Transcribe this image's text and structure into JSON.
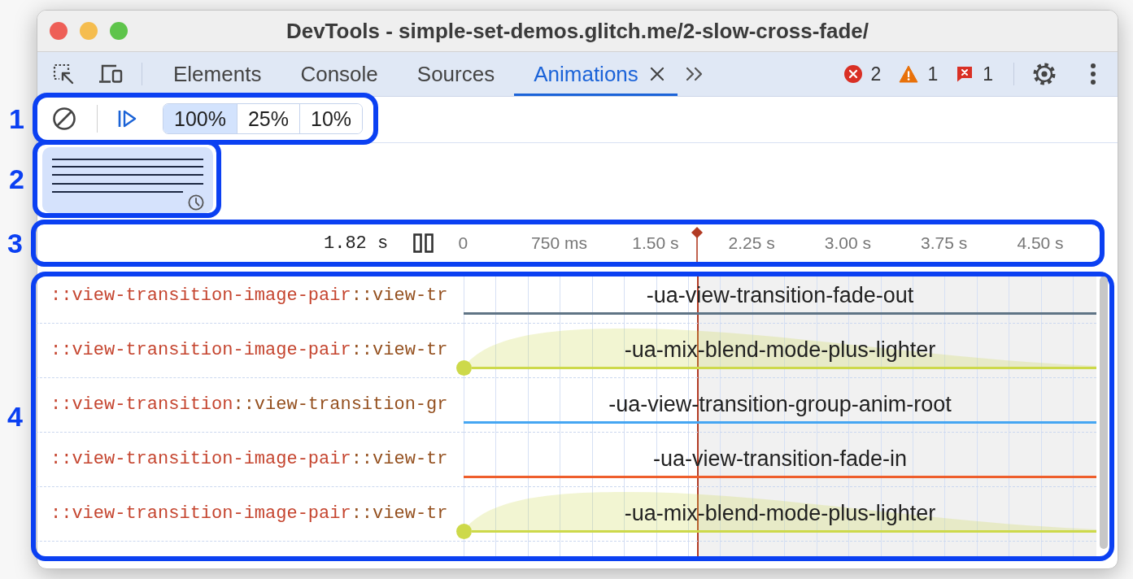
{
  "window": {
    "title": "DevTools - simple-set-demos.glitch.me/2-slow-cross-fade/"
  },
  "toolbar": {
    "tabs": [
      {
        "label": "Elements",
        "selected": false,
        "closable": false
      },
      {
        "label": "Console",
        "selected": false,
        "closable": false
      },
      {
        "label": "Sources",
        "selected": false,
        "closable": false
      },
      {
        "label": "Animations",
        "selected": true,
        "closable": true
      }
    ],
    "counters": [
      {
        "kind": "error",
        "count": "2"
      },
      {
        "kind": "warning",
        "count": "1"
      },
      {
        "kind": "issue",
        "count": "1"
      }
    ]
  },
  "controls": {
    "callout": "1",
    "playback_rates": [
      {
        "label": "100%",
        "selected": true
      },
      {
        "label": "25%",
        "selected": false
      },
      {
        "label": "10%",
        "selected": false
      }
    ]
  },
  "groups": {
    "callout": "2",
    "items": [
      {
        "selected": true
      }
    ]
  },
  "timeline": {
    "callout": "3",
    "current_time": "1.82 s",
    "ticks": [
      "0",
      "750 ms",
      "1.50 s",
      "2.25 s",
      "3.00 s",
      "3.75 s",
      "4.50 s"
    ],
    "playhead": {
      "level": 0.37
    }
  },
  "animations": {
    "callout": "4",
    "rows": [
      {
        "element": "::view-transition-image-pair",
        "pseudo": "::view-tr",
        "name": "-ua-view-transition-fade-out",
        "color": "#5f7485",
        "kind": "line"
      },
      {
        "element": "::view-transition-image-pair",
        "pseudo": "::view-tr",
        "name": "-ua-mix-blend-mode-plus-lighter",
        "color": "#cdd94a",
        "kind": "curve"
      },
      {
        "element": "::view-transition",
        "pseudo": "::view-transition-gr",
        "name": "-ua-view-transition-group-anim-root",
        "color": "#45a6f2",
        "kind": "line"
      },
      {
        "element": "::view-transition-image-pair",
        "pseudo": "::view-tr",
        "name": "-ua-view-transition-fade-in",
        "color": "#ee5e2c",
        "kind": "line"
      },
      {
        "element": "::view-transition-image-pair",
        "pseudo": "::view-tr",
        "name": "-ua-mix-blend-mode-plus-lighter",
        "color": "#cdd94a",
        "kind": "curve"
      }
    ]
  }
}
